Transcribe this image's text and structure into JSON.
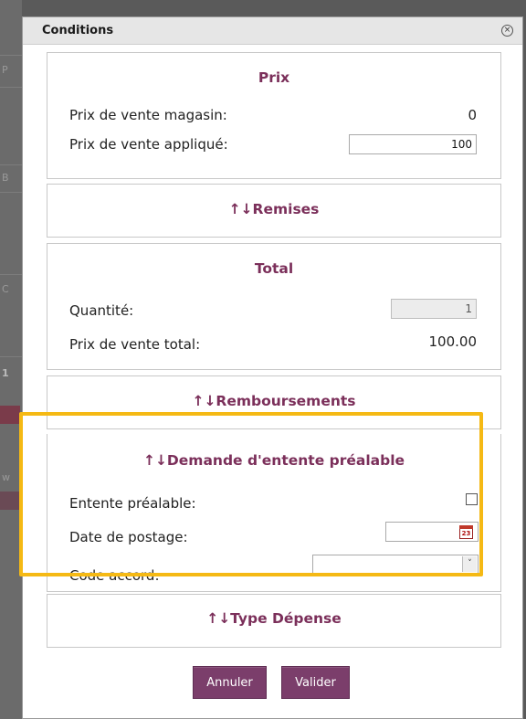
{
  "dialog": {
    "title": "Conditions",
    "close_symbol": "×"
  },
  "prix": {
    "title": "Prix",
    "store_price_label": "Prix de vente magasin:",
    "store_price_value": "0",
    "applied_price_label": "Prix de vente appliqué:",
    "applied_price_value": "100"
  },
  "remises": {
    "title": "↑↓Remises"
  },
  "total": {
    "title": "Total",
    "quantity_label": "Quantité:",
    "quantity_value": "1",
    "total_price_label": "Prix de vente total:",
    "total_price_value": "100.00"
  },
  "remboursements": {
    "title": "↑↓Remboursements"
  },
  "entente": {
    "title": "↑↓Demande d'entente préalable",
    "prior_agreement_label": "Entente préalable:",
    "posting_date_label": "Date de postage:",
    "posting_date_value": "",
    "calendar_day": "23",
    "agreement_code_label": "Code accord:",
    "agreement_code_value": ""
  },
  "type_depense": {
    "title": "↑↓Type Dépense"
  },
  "actions": {
    "cancel_label": "Annuler",
    "validate_label": "Valider"
  },
  "colors": {
    "accent": "#7b2f5a",
    "button": "#7b3e6b",
    "highlight": "#f5b914"
  },
  "icons": {
    "close": "close-icon",
    "calendar": "calendar-icon",
    "dropdown": "chevron-down-icon"
  }
}
